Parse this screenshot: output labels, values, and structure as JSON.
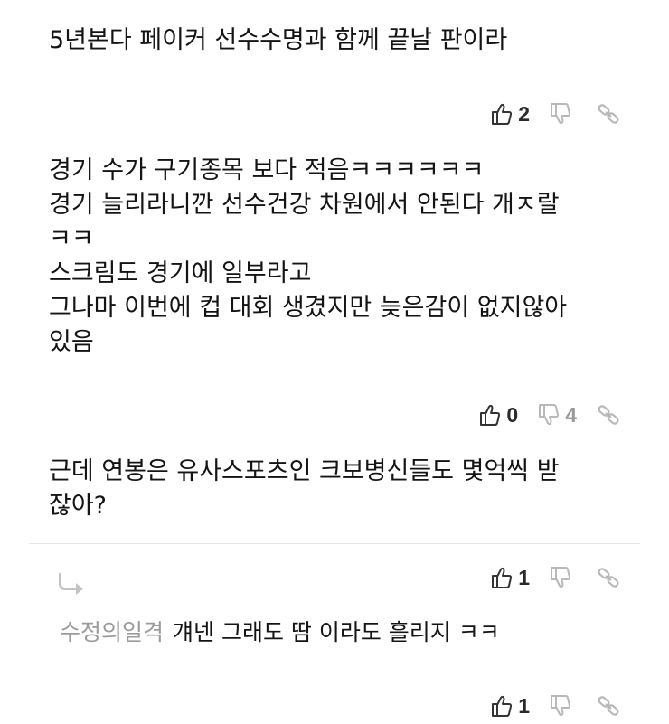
{
  "comments": [
    {
      "text": "5년본다 페이커 선수수명과 함께 끝날 판이라",
      "likes": "2",
      "dislikes": ""
    },
    {
      "text": "경기 수가 구기종목 보다 적음ㅋㅋㅋㅋㅋㅋ\n경기 늘리라니깐 선수건강 차원에서 안된다 개ㅈ랄\nㅋㅋ\n스크림도 경기에 일부라고\n그나마 이번에 컵 대회 생겼지만 늦은감이 없지않아\n있음",
      "likes": "0",
      "dislikes": "4"
    },
    {
      "text": "근데 연봉은 유사스포츠인 크보병신들도 몇억씩 받\n잖아?",
      "likes": "1",
      "dislikes": ""
    }
  ],
  "reply": {
    "author": "수정의일격",
    "text": "걔넨 그래도 땀 이라도 흘리지 ㅋㅋ",
    "likes": "1",
    "dislikes": ""
  },
  "icons": {
    "like": "thumbs-up-icon",
    "dislike": "thumbs-down-icon",
    "link": "link-icon",
    "reply": "reply-arrow-icon"
  },
  "colors": {
    "icon_dark": "#333333",
    "icon_light": "#b8b8b8",
    "divider": "#e6e6e6",
    "author": "#9b9b9b"
  }
}
